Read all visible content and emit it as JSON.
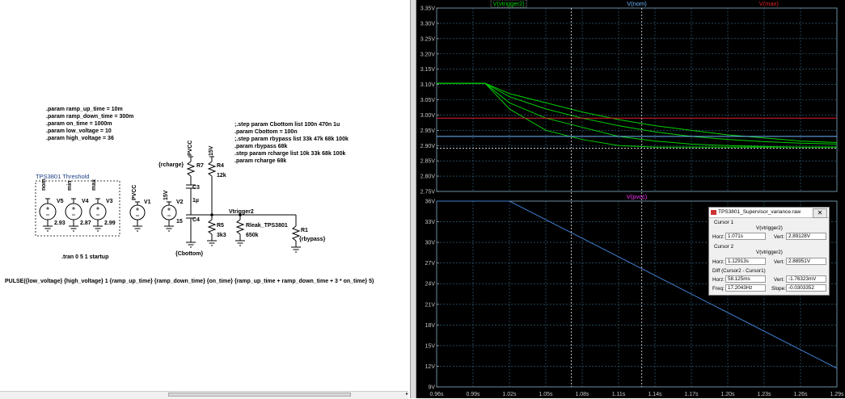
{
  "schematic": {
    "params": [
      ".param ramp_up_time = 10m",
      ".param ramp_down_time = 300m",
      ".param on_time = 1000m",
      ".param low_voltage = 10",
      ".param high_voltage = 36"
    ],
    "steps": [
      ";.step param Cbottom list 100n 470n 1u",
      ".param Cbottom = 100n",
      ";.step param rbypass list 33k 47k 68k 100k",
      ".param rbypass 68k",
      ".step param rcharge list 10k 33k 68k 100k",
      ".param rcharge 68k"
    ],
    "threshold_title": "TPS3801 Threshold",
    "sources": [
      {
        "net": "nom",
        "name": "V5",
        "value": "2.93"
      },
      {
        "net": "min",
        "name": "V4",
        "value": "2.87"
      },
      {
        "net": "max",
        "name": "V3",
        "value": "2.99"
      },
      {
        "net": "PVCC",
        "name": "V1",
        "value": ""
      },
      {
        "net": "15V",
        "name": "V2",
        "value": "15"
      }
    ],
    "components": {
      "pvcc_label": "PVCC",
      "v15_label": "15V",
      "rcharge": "{rcharge}",
      "r7": "R7",
      "r4": "R4",
      "r4_val": "12k",
      "c3": "C3",
      "c3_val": "1µ",
      "c4": "C4",
      "r5": "R5",
      "r5_val": "3k3",
      "cbottom": "{Cbottom}",
      "vtrigger2": "Vtrigger2",
      "rleak": "Rleak_TPS3801",
      "rleak_val": "650k",
      "r1": "R1",
      "r1_val": "{rbypass}"
    },
    "tran": ".tran 0 5 1 startup",
    "pulse": "PULSE({low_voltage} {high_voltage} 1 {ramp_up_time} {ramp_down_time} {on_time} {ramp_up_time + ramp_down_time + 3 * on_time} 5)"
  },
  "plot": {
    "top_traces": [
      {
        "label": "V(vtrigger2)",
        "color": "#00d000"
      },
      {
        "label": "V(nom)",
        "color": "#6fb6ff"
      },
      {
        "label": "V(max)",
        "color": "#e0202c"
      }
    ],
    "bottom_trace": {
      "label": "V(pvcc)",
      "color": "#ff30ff"
    },
    "top_yticks": [
      "3.35V",
      "3.30V",
      "3.25V",
      "3.20V",
      "3.15V",
      "3.10V",
      "3.05V",
      "3.00V",
      "2.95V",
      "2.90V",
      "2.85V",
      "2.80V",
      "2.75V"
    ],
    "bottom_yticks": [
      "36V",
      "33V",
      "30V",
      "27V",
      "24V",
      "21V",
      "18V",
      "15V",
      "12V",
      "9V"
    ],
    "xticks": [
      "0.96s",
      "0.99s",
      "1.02s",
      "1.05s",
      "1.08s",
      "1.11s",
      "1.14s",
      "1.17s",
      "1.20s",
      "1.23s",
      "1.26s",
      "1.29s"
    ],
    "grid_color": "#3a6e8a"
  },
  "chart_data": [
    {
      "type": "line",
      "x": [
        0.96,
        1.0,
        1.02,
        1.05,
        1.08,
        1.11,
        1.14,
        1.17,
        1.2,
        1.23,
        1.26,
        1.29
      ],
      "ylim": [
        2.75,
        3.35
      ],
      "xlim": [
        0.96,
        1.29
      ],
      "series": [
        {
          "name": "V(vtrigger2)",
          "values": [
            3.104,
            3.104,
            3.02,
            2.95,
            2.92,
            2.9,
            2.895,
            2.895,
            2.895,
            2.895,
            2.895,
            2.895
          ]
        },
        {
          "name": "V(vtrigger2)",
          "values": [
            3.104,
            3.104,
            3.04,
            2.99,
            2.96,
            2.93,
            2.915,
            2.905,
            2.9,
            2.897,
            2.895,
            2.895
          ]
        },
        {
          "name": "V(vtrigger2)",
          "values": [
            3.104,
            3.104,
            3.06,
            3.02,
            2.99,
            2.965,
            2.945,
            2.93,
            2.92,
            2.913,
            2.908,
            2.905
          ]
        },
        {
          "name": "V(vtrigger2)",
          "values": [
            3.104,
            3.104,
            3.07,
            3.04,
            3.01,
            2.985,
            2.965,
            2.95,
            2.935,
            2.925,
            2.915,
            2.91
          ]
        },
        {
          "name": "V(nom)",
          "values": [
            2.93,
            2.93,
            2.93,
            2.93,
            2.93,
            2.93,
            2.93,
            2.93,
            2.93,
            2.93,
            2.93,
            2.93
          ]
        },
        {
          "name": "V(max)",
          "values": [
            2.99,
            2.99,
            2.99,
            2.99,
            2.99,
            2.99,
            2.99,
            2.99,
            2.99,
            2.99,
            2.99,
            2.99
          ]
        }
      ]
    },
    {
      "type": "line",
      "x": [
        0.96,
        1.02,
        1.29
      ],
      "ylim": [
        9,
        36
      ],
      "xlim": [
        0.96,
        1.29
      ],
      "series": [
        {
          "name": "V(pvcc)",
          "values": [
            36,
            36,
            11.7
          ]
        }
      ]
    }
  ],
  "cursor_window": {
    "title": "TPS3801_Supervisor_variance.raw",
    "close": "✕",
    "cursor1": {
      "label": "Cursor 1",
      "trace": "V(vtrigger2)",
      "horz_label": "Horz:",
      "horz": "1.071s",
      "vert_label": "Vert:",
      "vert": "2.89128V"
    },
    "cursor2": {
      "label": "Cursor 2",
      "trace": "V(vtrigger2)",
      "horz_label": "Horz:",
      "horz": "1.12913s",
      "vert_label": "Vert:",
      "vert": "2.88951V"
    },
    "diff": {
      "label": "Diff (Cursor2 - Cursor1)",
      "horz_label": "Horz:",
      "horz": "58.125ms",
      "vert_label": "Vert:",
      "vert": "-1.76323mV",
      "freq_label": "Freq:",
      "freq": "17.2043Hz",
      "slope_label": "Slope:",
      "slope": "-0.0303352"
    }
  }
}
